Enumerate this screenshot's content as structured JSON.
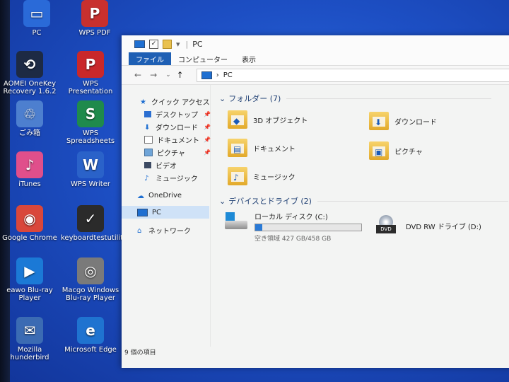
{
  "desktop": {
    "icons": [
      {
        "label": "PC",
        "glyph": "▭",
        "color": "#2a6ad8"
      },
      {
        "label": "WPS PDF",
        "glyph": "P",
        "color": "#c8302e"
      },
      {
        "label": "AOMEI OneKey\nRecovery 1.6.2",
        "glyph": "⟲",
        "color": "#1d2a44"
      },
      {
        "label": "WPS Presentation",
        "glyph": "P",
        "color": "#c9282a"
      },
      {
        "label": "ごみ箱",
        "glyph": "♲",
        "color": "#4d7fcf"
      },
      {
        "label": "WPS Spreadsheets",
        "glyph": "S",
        "color": "#1f8a4c"
      },
      {
        "label": "iTunes",
        "glyph": "♪",
        "color": "#e04f8b"
      },
      {
        "label": "WPS Writer",
        "glyph": "W",
        "color": "#2a62c9"
      },
      {
        "label": "Google Chrome",
        "glyph": "◉",
        "color": "#d9473b"
      },
      {
        "label": "keyboardtestutility",
        "glyph": "✓",
        "color": "#2b2b2b"
      },
      {
        "label": "eawo Blu-ray\nPlayer",
        "glyph": "▶",
        "color": "#1b79d6"
      },
      {
        "label": "Macgo Windows\nBlu-ray Player",
        "glyph": "◎",
        "color": "#7a7a7a"
      },
      {
        "label": "Mozilla\nhunderbird",
        "glyph": "✉",
        "color": "#3b6bb3"
      },
      {
        "label": "Microsoft Edge",
        "glyph": "e",
        "color": "#1f73d0"
      }
    ]
  },
  "window": {
    "title": "PC",
    "ribbon_tabs": [
      "ファイル",
      "コンピューター",
      "表示"
    ],
    "address": "PC",
    "nav_back": "←",
    "nav_forward": "→",
    "nav_recent": "⌄",
    "nav_up": "↑"
  },
  "nav": {
    "quick_access": "クイック アクセス",
    "items": [
      {
        "label": "デスクトップ",
        "pin": true
      },
      {
        "label": "ダウンロード",
        "pin": true
      },
      {
        "label": "ドキュメント",
        "pin": true
      },
      {
        "label": "ピクチャ",
        "pin": true
      },
      {
        "label": "ビデオ",
        "pin": false
      },
      {
        "label": "ミュージック",
        "pin": false
      }
    ],
    "onedrive": "OneDrive",
    "pc": "PC",
    "network": "ネットワーク",
    "pin_glyph": "📌"
  },
  "content": {
    "folders_header": "フォルダー (7)",
    "folders": [
      {
        "label": "3D オブジェクト",
        "mark": "◆"
      },
      {
        "label": "ダウンロード",
        "mark": "⬇"
      },
      {
        "label": "ドキュメント",
        "mark": "▤"
      },
      {
        "label": "ピクチャ",
        "mark": "▣"
      },
      {
        "label": "ミュージック",
        "mark": "♪"
      }
    ],
    "drives_header": "デバイスとドライブ (2)",
    "drives": [
      {
        "label": "ローカル ディスク (C:)",
        "free_text": "空き領域 427 GB/458 GB",
        "used_fraction": 0.068
      },
      {
        "label": "DVD RW ドライブ (D:)"
      }
    ]
  },
  "status": {
    "items_count": "9 個の項目"
  }
}
